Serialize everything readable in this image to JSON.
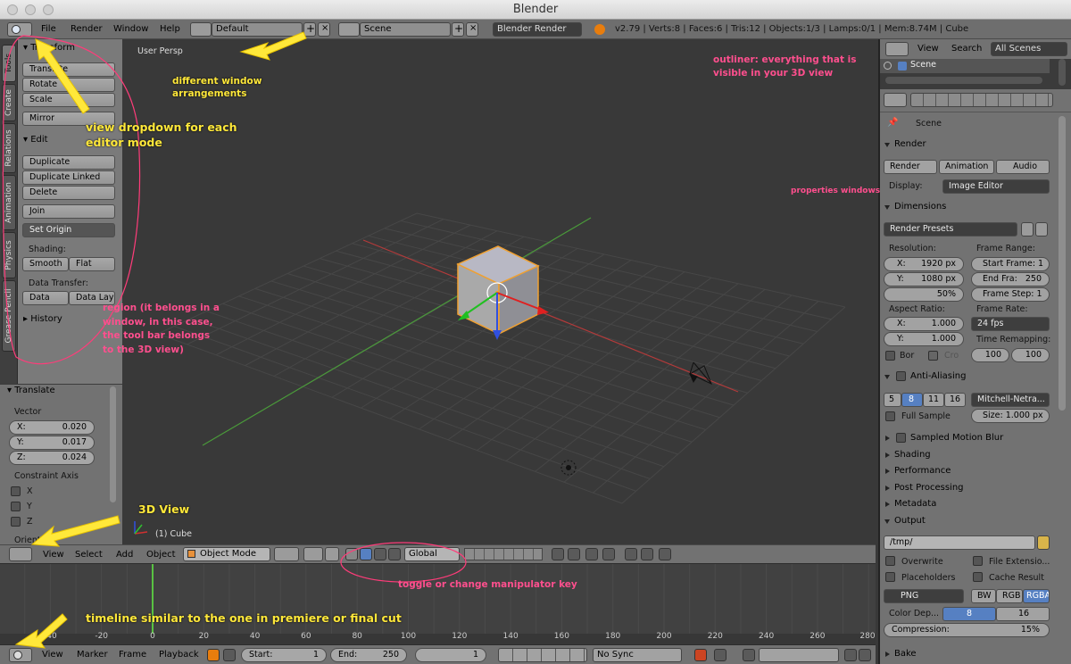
{
  "window": {
    "title": "Blender"
  },
  "info_header": {
    "menus": [
      "File",
      "Render",
      "Window",
      "Help"
    ],
    "layout": "Default",
    "scene": "Scene",
    "engine": "Blender Render",
    "stats": "v2.79 | Verts:8 | Faces:6 | Tris:12 | Objects:1/3 | Lamps:0/1 | Mem:8.74M | Cube"
  },
  "tool_tabs": [
    "Tools",
    "Create",
    "Relations",
    "Animation",
    "Physics",
    "Grease Pencil"
  ],
  "tool_shelf": {
    "transform_header": "Transform",
    "transform_buttons": [
      "Translate",
      "Rotate",
      "Scale"
    ],
    "mirror": "Mirror",
    "edit_header": "Edit",
    "edit_buttons": [
      "Duplicate",
      "Duplicate Linked",
      "Delete"
    ],
    "join": "Join",
    "set_origin": "Set Origin",
    "shading_label": "Shading:",
    "smooth": "Smooth",
    "flat": "Flat",
    "data_transfer_label": "Data Transfer:",
    "data": "Data",
    "data_lay": "Data Lay",
    "history": "History"
  },
  "operator_panel": {
    "header": "Translate",
    "vector_label": "Vector",
    "x_label": "X:",
    "x": "0.020",
    "y_label": "Y:",
    "y": "0.017",
    "z_label": "Z:",
    "z": "0.024",
    "constraint_label": "Constraint Axis",
    "axes": [
      "X",
      "Y",
      "Z"
    ],
    "orient_label": "Orientati"
  },
  "viewport": {
    "view_name": "User Persp",
    "object_label": "(1) Cube"
  },
  "view3d_header": {
    "menus": [
      "View",
      "Select",
      "Add",
      "Object"
    ],
    "mode": "Object Mode",
    "orientation": "Global"
  },
  "timeline": {
    "ticks": [
      "-40",
      "-20",
      "0",
      "20",
      "40",
      "60",
      "80",
      "100",
      "120",
      "140",
      "160",
      "180",
      "200",
      "220",
      "240",
      "260",
      "280"
    ],
    "menus": [
      "View",
      "Marker",
      "Frame",
      "Playback"
    ],
    "start_label": "Start:",
    "start": "1",
    "end_label": "End:",
    "end": "250",
    "current": "1",
    "sync": "No Sync"
  },
  "outliner": {
    "menus": [
      "View",
      "Search"
    ],
    "filter": "All Scenes",
    "scene_item": "Scene"
  },
  "properties": {
    "context": "Scene",
    "render_header": "Render",
    "render_btn": "Render",
    "animation_btn": "Animation",
    "audio_btn": "Audio",
    "display_label": "Display:",
    "display": "Image Editor",
    "dimensions_header": "Dimensions",
    "presets": "Render Presets",
    "resolution_label": "Resolution:",
    "res_x_label": "X:",
    "res_x": "1920 px",
    "res_y_label": "Y:",
    "res_y": "1080 px",
    "res_pct": "50%",
    "frame_range_label": "Frame Range:",
    "start_frame": "Start Frame: 1",
    "end_frame_label": "End Fra:",
    "end_frame": "250",
    "frame_step": "Frame Step: 1",
    "aspect_label": "Aspect Ratio:",
    "asp_x_label": "X:",
    "asp_x": "1.000",
    "asp_y_label": "Y:",
    "asp_y": "1.000",
    "bor": "Bor",
    "cro": "Cro",
    "frame_rate_label": "Frame Rate:",
    "fps": "24 fps",
    "time_remap_label": "Time Remapping:",
    "remap_old": "100",
    "remap_new": "100",
    "aa_header": "Anti-Aliasing",
    "aa_samples": [
      "5",
      "8",
      "11",
      "16"
    ],
    "aa_filter": "Mitchell-Netra...",
    "full_sample": "Full Sample",
    "size": "Size: 1.000 px",
    "collapsed": [
      "Sampled Motion Blur",
      "Shading",
      "Performance",
      "Post Processing",
      "Metadata"
    ],
    "output_header": "Output",
    "output_path": "/tmp/",
    "overwrite": "Overwrite",
    "file_ext": "File Extensio...",
    "placeholders": "Placeholders",
    "cache_result": "Cache Result",
    "format": "PNG",
    "bw": "BW",
    "rgb": "RGB",
    "rgba": "RGBA",
    "color_depth_label": "Color Dep...",
    "depth8": "8",
    "depth16": "16",
    "compression": "Compression:",
    "compression_val": "15%",
    "bake": "Bake"
  },
  "annotations": {
    "editor_dropdown": "view dropdown for each\neditor mode",
    "window_arrangements": "different window\narrangements",
    "outliner_note": "outliner: everything that is\nvisible in your 3D view",
    "properties_note": "properties windows",
    "region_note": "region (it belongs in a\nwindow, in this case,\nthe tool bar belongs\nto the 3D view)",
    "view3d_note": "3D View",
    "manipulator_note": "toggle or change manipulator key",
    "timeline_note": "timeline similar to the one in premiere or final cut"
  },
  "colors": {
    "annotation_yellow": "#ffe83a",
    "annotation_pink": "#ff4f8e",
    "selection_blue": "#5680c2",
    "cube_outline": "#f0a030"
  }
}
